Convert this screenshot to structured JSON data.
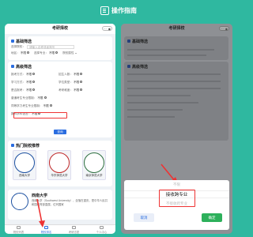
{
  "header": {
    "title": "操作指南",
    "icon": "guide-icon"
  },
  "left": {
    "app_title": "考研择校",
    "basic": {
      "title": "基础筛选",
      "keyword_label": "选择院校：",
      "keyword_placeholder": "请输入名称或者简写",
      "filters": [
        {
          "label": "地区：",
          "value": "不限"
        },
        {
          "label": "选择专业：",
          "value": "不限"
        },
        {
          "label": "院校属性",
          "value": ""
        }
      ]
    },
    "advanced": {
      "title": "高级筛选",
      "rows": [
        [
          {
            "label": "报考方式：",
            "value": "不限"
          },
          {
            "label": "招生人数：",
            "value": "不限"
          }
        ],
        [
          {
            "label": "学习方式：",
            "value": "不限"
          },
          {
            "label": "学位类型：",
            "value": "不限"
          }
        ],
        [
          {
            "label": "是否报考：",
            "value": "不限"
          },
          {
            "label": "考研难度：",
            "value": "不限"
          }
        ],
        [
          {
            "label": "普通考生专业限制：",
            "value": "不限"
          }
        ],
        [
          {
            "label": "同等学力考生专业限制：",
            "value": "不限"
          }
        ],
        [
          {
            "label": "数科学科语言：",
            "value": "不限"
          }
        ]
      ],
      "query_button": "查询"
    },
    "hot": {
      "title": "热门院校推荐",
      "universities": [
        "西南大学",
        "华东师范大学",
        "南京师范大学"
      ]
    },
    "feature": {
      "name": "西南大学",
      "desc": "西南大学（Southwest University），坐落在重庆，是中华人民共和国教育部直属，位列国家"
    },
    "tabs": [
      "院校列表",
      "院校排名",
      "考研志愿",
      "个人中心"
    ]
  },
  "right": {
    "app_title": "考研择校",
    "basic_title": "基础筛选",
    "advanced_title": "高级筛选",
    "picker": {
      "items": [
        "不限",
        "接收跨专业",
        "不接收跨专业"
      ],
      "selected": "接收跨专业"
    },
    "cancel": "取消",
    "confirm": "确定"
  },
  "colors": {
    "background": "#2fb8a0",
    "accent_blue": "#2a6de0",
    "highlight_red": "#e33333",
    "confirm_green": "#2db05b"
  }
}
